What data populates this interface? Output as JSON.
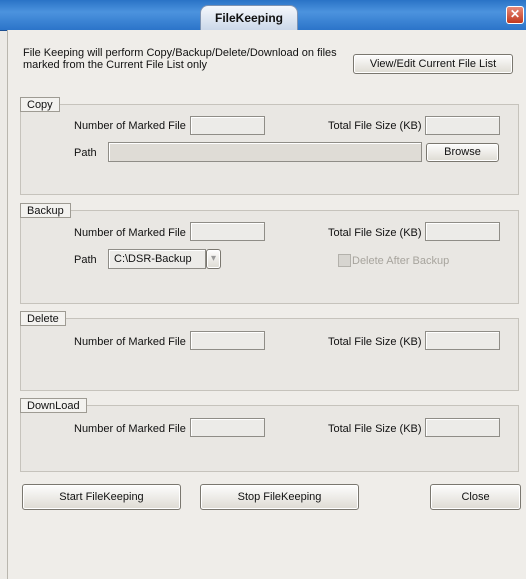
{
  "window": {
    "title": "FileKeeping",
    "close_glyph": "✕"
  },
  "intro": {
    "line1": "File Keeping will perform Copy/Backup/Delete/Download on files",
    "line2": "marked from the Current File List only",
    "view_edit_label": "View/Edit Current File List"
  },
  "copy": {
    "title": "Copy",
    "marked_label": "Number of Marked File",
    "marked_value": "",
    "size_label": "Total File Size (KB)",
    "size_value": "",
    "path_label": "Path",
    "path_value": "",
    "browse_label": "Browse"
  },
  "backup": {
    "title": "Backup",
    "marked_label": "Number of Marked File",
    "marked_value": "",
    "size_label": "Total File Size (KB)",
    "size_value": "",
    "path_label": "Path",
    "path_value": "C:\\DSR-Backup",
    "dropdown_glyph": "▾",
    "delete_after_label": "Delete After Backup",
    "delete_after_checked": false
  },
  "delete": {
    "title": "Delete",
    "marked_label": "Number of Marked File",
    "marked_value": "",
    "size_label": "Total File Size (KB)",
    "size_value": ""
  },
  "download": {
    "title": "DownLoad",
    "marked_label": "Number of Marked File",
    "marked_value": "",
    "size_label": "Total File Size (KB)",
    "size_value": ""
  },
  "actions": {
    "start_label": "Start FileKeeping",
    "stop_label": "Stop FileKeeping",
    "close_label": "Close"
  }
}
